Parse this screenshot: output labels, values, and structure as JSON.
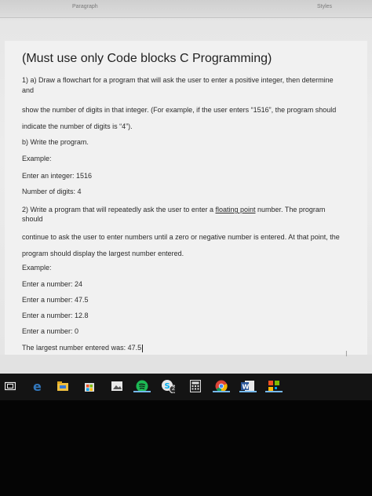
{
  "ribbon": {
    "paragraph_label": "Paragraph",
    "styles_label": "Styles"
  },
  "document": {
    "title": "(Must use only Code blocks C Programming)",
    "lines": {
      "l1": "1) a) Draw a flowchart for a program that will ask the user to enter a positive integer, then determine",
      "l2": "and",
      "l3": "show the number of digits in that integer. (For example, if the user enters “1516”, the program should",
      "l4": "indicate the number of digits is “4”).",
      "l5": "b) Write the program.",
      "l6": "Example:",
      "l7": "Enter an integer: 1516",
      "l8": "Number of digits: 4",
      "l9a": "2) Write a program that will repeatedly ask the user to enter a ",
      "l9b": "floating point",
      "l9c": " number. The program",
      "l10": "should",
      "l11": "continue to ask the user to enter numbers until a zero or negative number is entered. At that point, the",
      "l12": "program should display the largest number entered.",
      "l13": "Example:",
      "l14": "Enter a number: 24",
      "l15": "Enter a number: 47.5",
      "l16": "Enter a number: 12.8",
      "l17": "Enter a number: 0",
      "l18": "The largest number entered was: 47.5"
    }
  },
  "taskbar": {
    "icons": [
      "task-view-icon",
      "edge-icon",
      "file-explorer-icon",
      "store-icon",
      "photos-icon",
      "spotify-icon",
      "skype-icon",
      "calculator-icon",
      "chrome-icon",
      "word-icon",
      "app-icon"
    ],
    "skype_badge": "2"
  },
  "colors": {
    "taskbar": "#141414",
    "edge": "#3277bc",
    "spotify": "#1db954",
    "word": "#2b579a",
    "active_indicator": "#76b9ed"
  }
}
